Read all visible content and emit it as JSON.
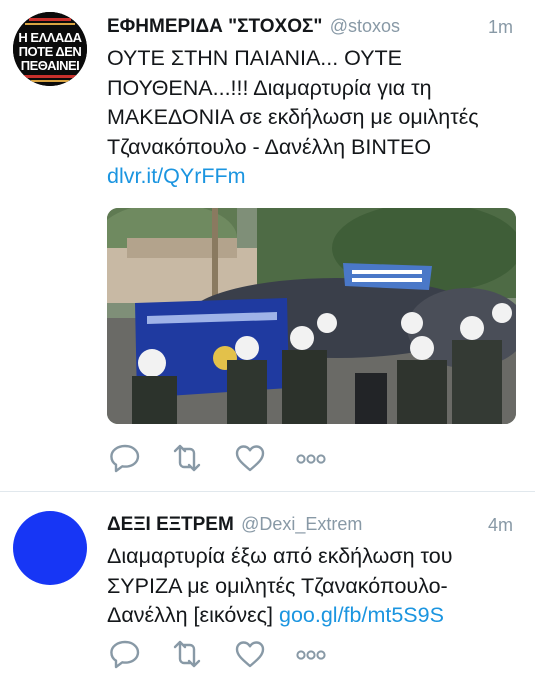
{
  "tweets": [
    {
      "display_name": "ΕΦΗΜΕΡΙΔΑ \"ΣΤΟΧΟΣ\"",
      "handle": "@stoxos",
      "time": "1m",
      "avatar_text": {
        "line1": "Η ΕΛΛΑΔΑ",
        "line2": "ΠΟΤΕ ΔΕΝ",
        "line3": "ΠΕΘΑΙΝΕΙ"
      },
      "text": "ΟΥΤΕ ΣΤΗΝ ΠΑΙΑΝΙΑ... ΟΥΤΕ ΠΟΥΘΕΝΑ...!!! Διαμαρτυρία για τη ΜΑΚΕΔΟΝΙΑ σε εκδήλωση με ομιλητές Τζανακόπουλο - Δανέλλη ΒΙΝΤΕΟ",
      "link": "dlvr.it/QYrFFm",
      "has_media": true,
      "actions": [
        "reply-icon",
        "retweet-icon",
        "like-icon",
        "more-icon"
      ]
    },
    {
      "display_name": "ΔΕΞΙ ΕΞΤΡΕΜ",
      "handle": "@Dexi_Extrem",
      "time": "4m",
      "avatar_color": "#1736f5",
      "text": "Διαμαρτυρία έξω από εκδήλωση του ΣΥΡΙΖΑ με ομιλητές Τζανακόπουλο-Δανέλλη [εικόνες]",
      "link": "goo.gl/fb/mt5S9S",
      "has_media": false,
      "actions": [
        "reply-icon",
        "retweet-icon",
        "like-icon",
        "more-icon"
      ]
    }
  ],
  "colors": {
    "name": "#14171a",
    "meta": "#8899a6",
    "link": "#1b95e0",
    "icon": "#8899a6",
    "divider": "#e1e8ed"
  }
}
